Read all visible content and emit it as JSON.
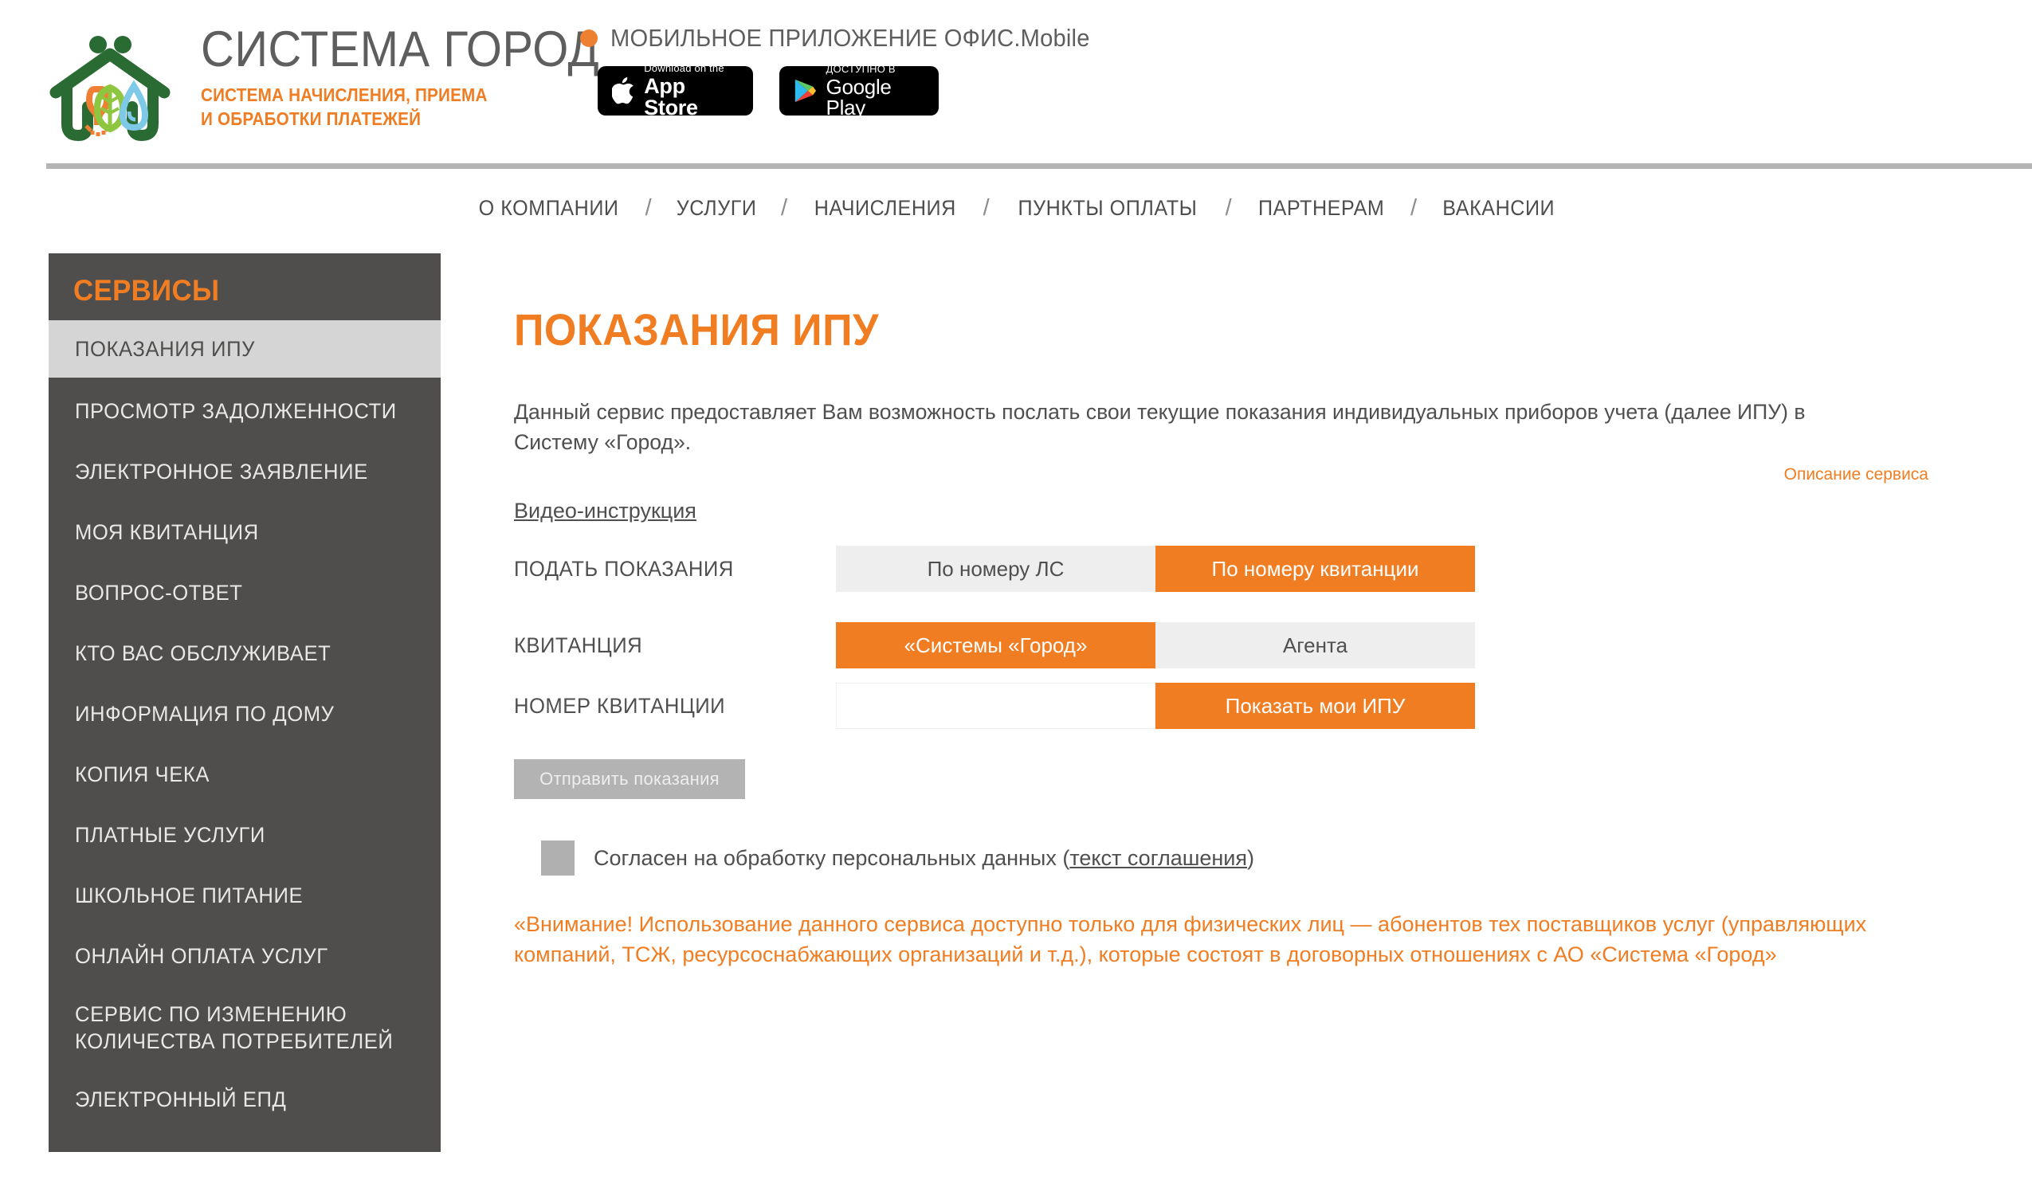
{
  "header": {
    "brand_title": "СИСТЕМА ГОРОД",
    "brand_sub_line1": "СИСТЕМА НАЧИСЛЕНИЯ, ПРИЕМА",
    "brand_sub_line2": "И ОБРАБОТКИ ПЛАТЕЖЕЙ",
    "mobile_title": "МОБИЛЬНОЕ ПРИЛОЖЕНИЕ ОФИС.Mobile",
    "appstore_small": "Download on the",
    "appstore_big": "App Store",
    "googleplay_small": "ДОСТУПНО В",
    "googleplay_big": "Google Play"
  },
  "nav": {
    "separator": "/",
    "items": [
      {
        "label": "О КОМПАНИИ"
      },
      {
        "label": "УСЛУГИ"
      },
      {
        "label": "НАЧИСЛЕНИЯ"
      },
      {
        "label": "ПУНКТЫ ОПЛАТЫ"
      },
      {
        "label": "ПАРТНЕРАМ"
      },
      {
        "label": "ВАКАНСИИ"
      }
    ]
  },
  "sidebar": {
    "title": "СЕРВИСЫ",
    "items": [
      {
        "label": "ПОКАЗАНИЯ ИПУ",
        "active": true
      },
      {
        "label": "ПРОСМОТР ЗАДОЛЖЕННОСТИ",
        "active": false
      },
      {
        "label": "ЭЛЕКТРОННОЕ ЗАЯВЛЕНИЕ",
        "active": false
      },
      {
        "label": "МОЯ КВИТАНЦИЯ",
        "active": false
      },
      {
        "label": "ВОПРОС-ОТВЕТ",
        "active": false
      },
      {
        "label": "КТО ВАС ОБСЛУЖИВАЕТ",
        "active": false
      },
      {
        "label": "ИНФОРМАЦИЯ ПО ДОМУ",
        "active": false
      },
      {
        "label": "КОПИЯ ЧЕКА",
        "active": false
      },
      {
        "label": "ПЛАТНЫЕ УСЛУГИ",
        "active": false
      },
      {
        "label": "ШКОЛЬНОЕ ПИТАНИЕ",
        "active": false
      },
      {
        "label": "ОНЛАЙН ОПЛАТА УСЛУГ",
        "active": false
      },
      {
        "label": "СЕРВИС ПО ИЗМЕНЕНИЮ КОЛИЧЕСТВА ПОТРЕБИТЕЛЕЙ",
        "active": false
      },
      {
        "label": "ЭЛЕКТРОННЫЙ ЕПД",
        "active": false
      }
    ]
  },
  "main": {
    "page_title": "ПОКАЗАНИЯ ИПУ",
    "intro": "Данный сервис предоставляет Вам возможность послать свои текущие показания индивидуальных приборов учета (далее ИПУ) в Систему «Город».",
    "service_description_link": "Описание сервиса",
    "video_link": "Видео-инструкция",
    "form": {
      "row_submit_label": "ПОДАТЬ ПОКАЗАНИЯ",
      "submit_option_ls": "По номеру ЛС",
      "submit_option_receipt": "По номеру квитанции",
      "row_receipt_label": "КВИТАНЦИЯ",
      "receipt_option_system": "«Системы «Город»",
      "receipt_option_agent": "Агента",
      "row_number_label": "НОМЕР КВИТАНЦИИ",
      "receipt_number_value": "",
      "receipt_number_placeholder": "",
      "show_my_ipu_button": "Показать мои ИПУ",
      "send_readings_button": "Отправить показания"
    },
    "consent": {
      "text_before": "Согласен на обработку персональных данных (",
      "link": "текст соглашения",
      "text_after": ")",
      "checked": false
    },
    "warning": "«Внимание! Использование данного сервиса доступно только для физических лиц — абонентов тех поставщиков услуг (управляющих компаний, ТСЖ, ресурсоснабжающих организаций и т.д.), которые состоят в договорных отношениях с АО «Система «Город»"
  },
  "colors": {
    "accent": "#f07d22",
    "sidebar_bg": "#4f4e4c",
    "text": "#4f4f4f",
    "segment_off": "#eeeeee",
    "disabled": "#b3b3b3"
  }
}
